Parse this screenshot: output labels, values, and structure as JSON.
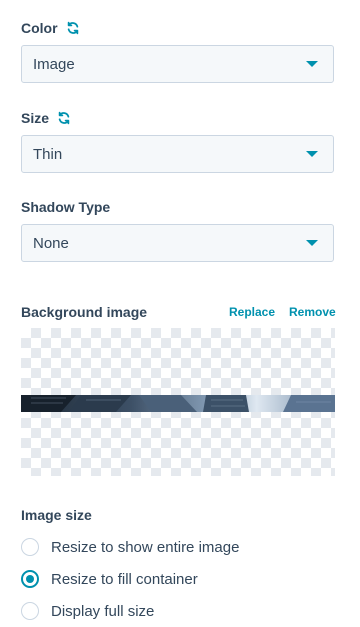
{
  "color": {
    "label": "Color",
    "value": "Image"
  },
  "size": {
    "label": "Size",
    "value": "Thin"
  },
  "shadow": {
    "label": "Shadow Type",
    "value": "None"
  },
  "background_image": {
    "label": "Background image",
    "replace_label": "Replace",
    "remove_label": "Remove"
  },
  "image_size": {
    "label": "Image size",
    "options": [
      {
        "label": "Resize to show entire image",
        "selected": false
      },
      {
        "label": "Resize to fill container",
        "selected": true
      },
      {
        "label": "Display full size",
        "selected": false
      }
    ]
  },
  "colors": {
    "accent": "#0091ae",
    "text": "#33475b",
    "border": "#cbd6e2"
  }
}
